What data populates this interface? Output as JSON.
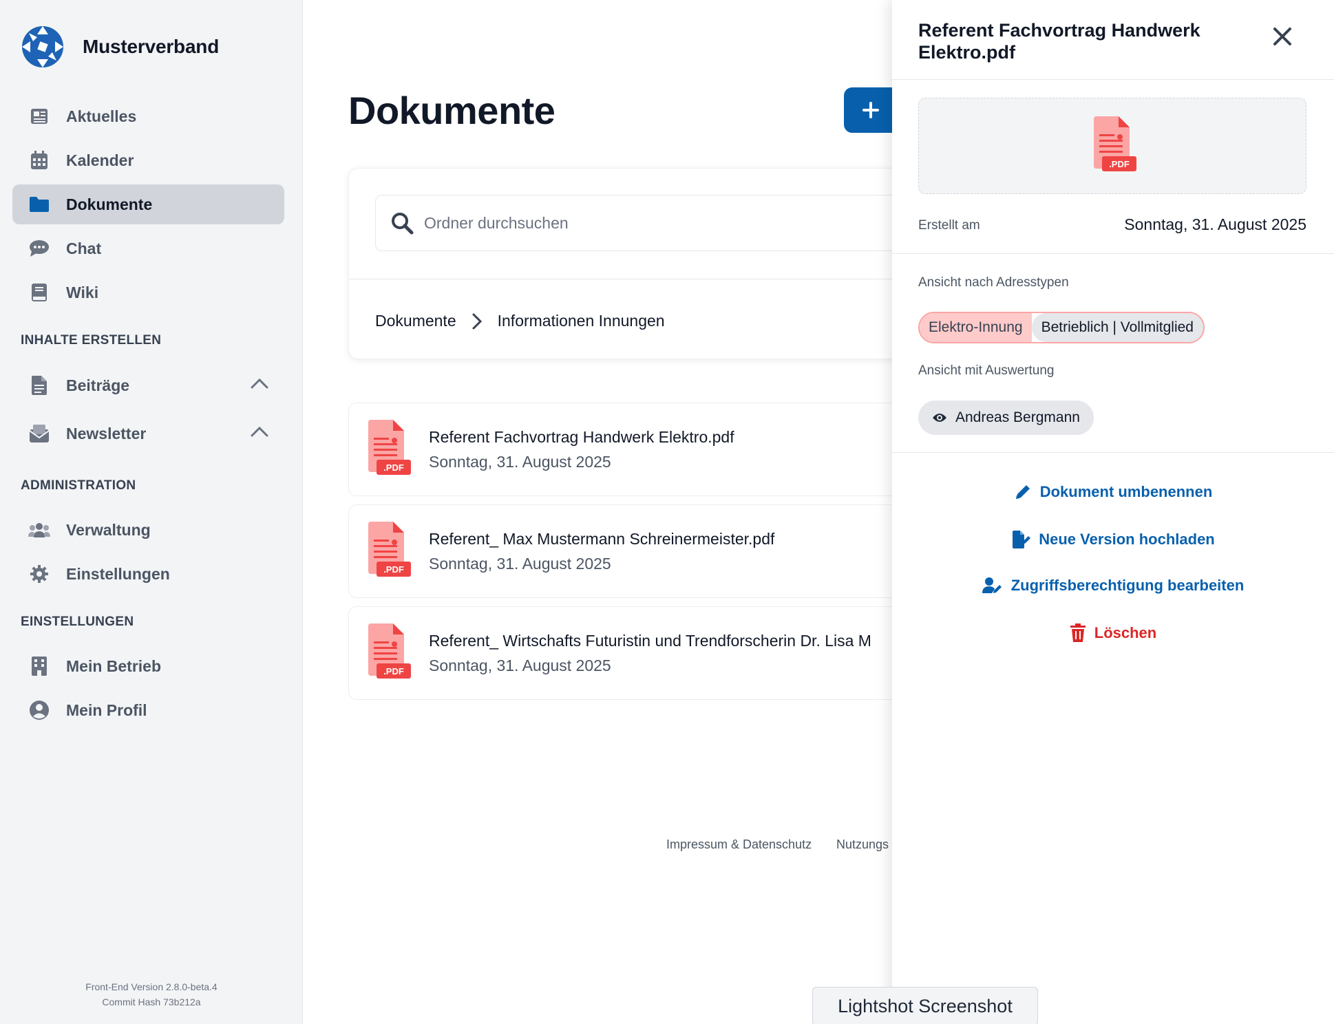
{
  "brand": {
    "name": "Musterverband"
  },
  "sidebar": {
    "items": [
      {
        "label": "Aktuelles",
        "icon": "newspaper-icon"
      },
      {
        "label": "Kalender",
        "icon": "calendar-icon"
      },
      {
        "label": "Dokumente",
        "icon": "folder-icon",
        "active": true
      },
      {
        "label": "Chat",
        "icon": "chat-icon"
      },
      {
        "label": "Wiki",
        "icon": "book-icon"
      }
    ],
    "section_create": "INHALTE ERSTELLEN",
    "create_items": [
      {
        "label": "Beiträge",
        "icon": "file-icon"
      },
      {
        "label": "Newsletter",
        "icon": "envelope-icon"
      }
    ],
    "section_admin": "ADMINISTRATION",
    "admin_items": [
      {
        "label": "Verwaltung",
        "icon": "users-icon"
      },
      {
        "label": "Einstellungen",
        "icon": "gear-icon"
      }
    ],
    "section_settings": "EINSTELLUNGEN",
    "settings_items": [
      {
        "label": "Mein Betrieb",
        "icon": "building-icon"
      },
      {
        "label": "Mein Profil",
        "icon": "user-circle-icon"
      }
    ],
    "version": "Front-End Version 2.8.0-beta.4",
    "commit": "Commit Hash 73b212a"
  },
  "main": {
    "title": "Dokumente",
    "search_placeholder": "Ordner durchsuchen",
    "breadcrumb": [
      "Dokumente",
      "Informationen Innungen"
    ],
    "documents": [
      {
        "name": "Referent Fachvortrag Handwerk Elektro.pdf",
        "date": "Sonntag, 31. August 2025",
        "badge": ".PDF"
      },
      {
        "name": "Referent_ Max Mustermann Schreinermeister.pdf",
        "date": "Sonntag, 31. August 2025",
        "badge": ".PDF"
      },
      {
        "name": "Referent_ Wirtschafts Futuristin und Trendforscherin Dr. Lisa M",
        "date": "Sonntag, 31. August 2025",
        "badge": ".PDF"
      }
    ],
    "footer": {
      "impressum": "Impressum & Datenschutz",
      "nutzung": "Nutzungs"
    }
  },
  "drawer": {
    "title": "Referent Fachvortrag Handwerk Elektro.pdf",
    "preview_badge": ".PDF",
    "created_label": "Erstellt am",
    "created_value": "Sonntag, 31. August 2025",
    "address_types_label": "Ansicht nach Adresstypen",
    "chip_primary": "Elektro-Innung",
    "chip_secondary": "Betrieblich | Vollmitglied",
    "evaluation_label": "Ansicht mit Auswertung",
    "viewer": "Andreas Bergmann",
    "actions": {
      "rename": "Dokument umbenennen",
      "upload": "Neue Version hochladen",
      "access": "Zugriffsberechtigung bearbeiten",
      "delete": "Löschen"
    }
  },
  "overlay": {
    "lightshot": "Lightshot Screenshot"
  },
  "colors": {
    "primary": "#0860ad",
    "danger": "#dc2626",
    "pdf_red": "#ef4444",
    "pdf_light": "#fca5a5"
  }
}
